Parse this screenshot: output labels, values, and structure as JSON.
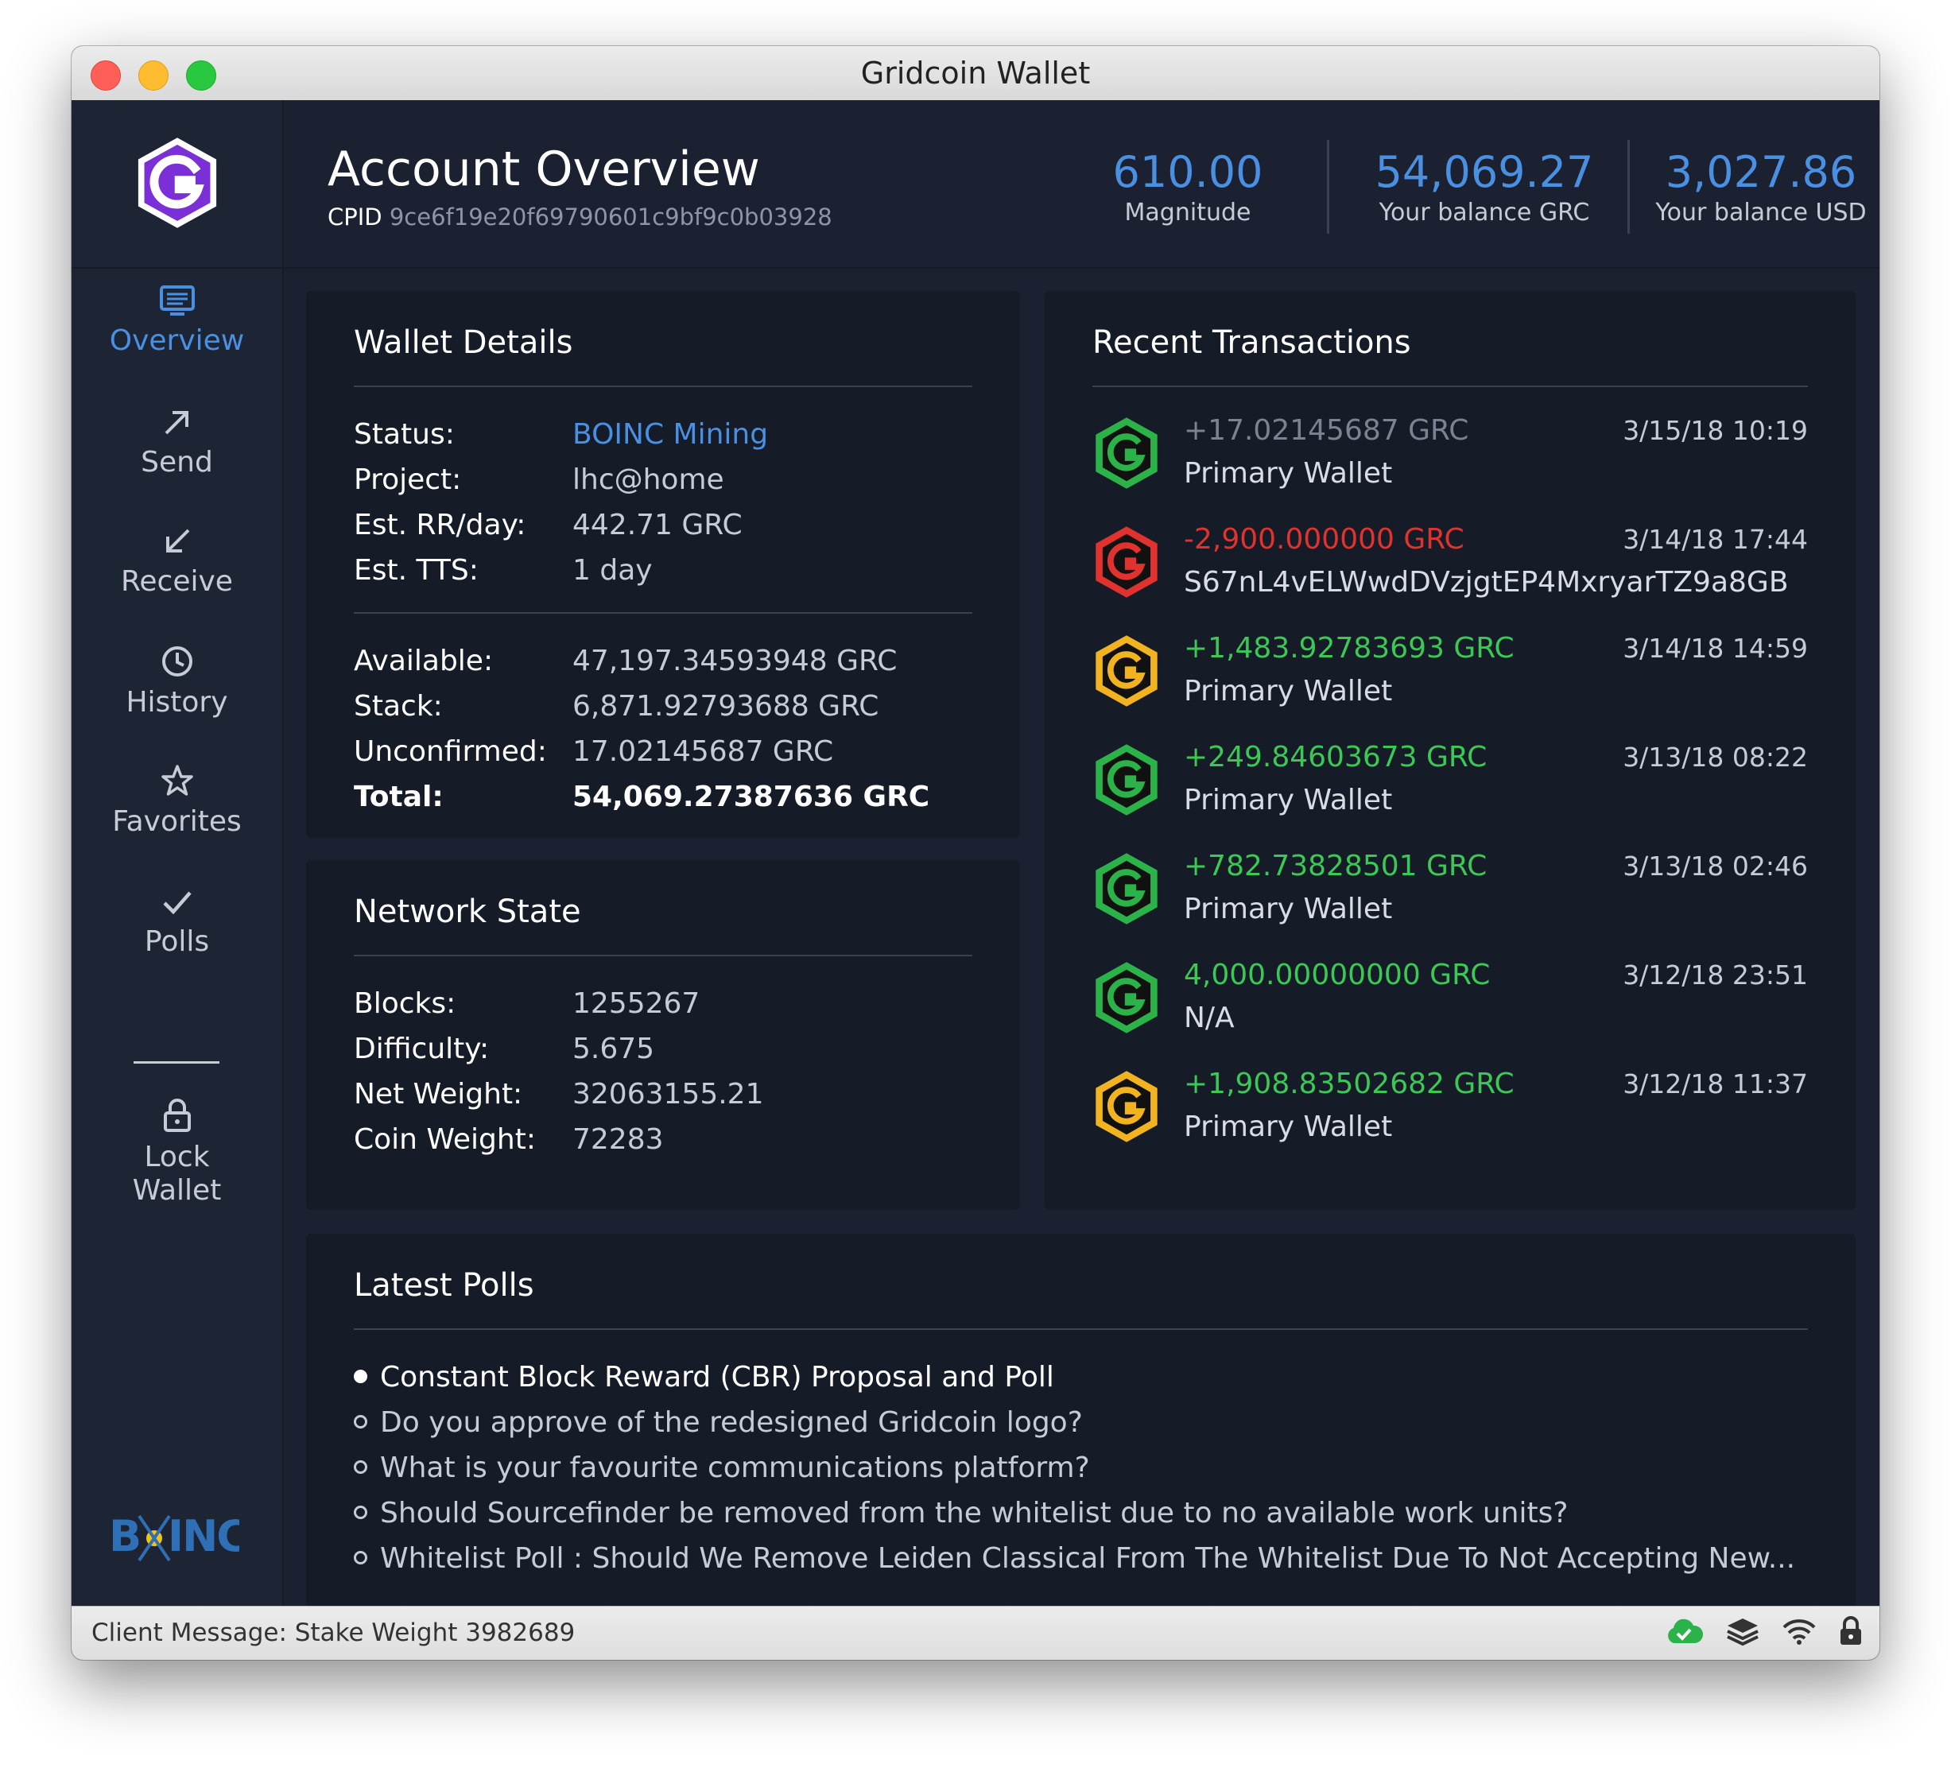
{
  "window": {
    "title": "Gridcoin Wallet"
  },
  "header": {
    "title": "Account Overview",
    "cpid_label": "CPID",
    "cpid_value": "9ce6f19e20f69790601c9bf9c0b03928",
    "stats": [
      {
        "value": "610.00",
        "caption": "Magnitude"
      },
      {
        "value": "54,069.27",
        "caption": "Your balance GRC"
      },
      {
        "value": "3,027.86",
        "caption": "Your balance USD"
      }
    ]
  },
  "sidebar": {
    "items": [
      {
        "label": "Overview",
        "icon": "monitor-icon",
        "active": true
      },
      {
        "label": "Send",
        "icon": "arrow-up-right-icon"
      },
      {
        "label": "Receive",
        "icon": "arrow-down-left-icon"
      },
      {
        "label": "History",
        "icon": "clock-icon"
      },
      {
        "label": "Favorites",
        "icon": "star-icon"
      },
      {
        "label": "Polls",
        "icon": "checkmark-icon"
      }
    ],
    "lock": {
      "line1": "Lock",
      "line2": "Wallet",
      "icon": "lock-icon"
    }
  },
  "wallet_details": {
    "title": "Wallet Details",
    "rows1": [
      {
        "key": "Status:",
        "value": "BOINC Mining"
      },
      {
        "key": "Project:",
        "value": "lhc@home"
      },
      {
        "key": "Est. RR/day:",
        "value": "442.71 GRC"
      },
      {
        "key": "Est. TTS:",
        "value": "1 day"
      }
    ],
    "rows2": [
      {
        "key": "Available:",
        "value": "47,197.34593948 GRC"
      },
      {
        "key": "Stack:",
        "value": "6,871.92793688 GRC"
      },
      {
        "key": "Unconfirmed:",
        "value": "17.02145687 GRC"
      },
      {
        "key": "Total:",
        "value": "54,069.27387636 GRC"
      }
    ]
  },
  "network_state": {
    "title": "Network State",
    "rows": [
      {
        "key": "Blocks:",
        "value": "1255267"
      },
      {
        "key": "Difficulty:",
        "value": "5.675"
      },
      {
        "key": "Net Weight:",
        "value": "32063155.21"
      },
      {
        "key": "Coin Weight:",
        "value": "72283"
      }
    ]
  },
  "recent_transactions": {
    "title": "Recent Transactions",
    "items": [
      {
        "amount": "+17.02145687 GRC",
        "date": "3/15/18 10:19",
        "address": "Primary Wallet",
        "kind": "neutral",
        "icon_color": "#2bb34a"
      },
      {
        "amount": "-2,900.000000 GRC",
        "date": "3/14/18 17:44",
        "address": "S67nL4vELWwdDVzjgtEP4MxryarTZ9a8GB",
        "kind": "neg",
        "icon_color": "#e0322f"
      },
      {
        "amount": "+1,483.92783693 GRC",
        "date": "3/14/18 14:59",
        "address": "Primary Wallet",
        "kind": "pos",
        "icon_color": "#f2b321"
      },
      {
        "amount": "+249.84603673 GRC",
        "date": "3/13/18 08:22",
        "address": "Primary Wallet",
        "kind": "pos",
        "icon_color": "#2bb34a"
      },
      {
        "amount": "+782.73828501 GRC",
        "date": "3/13/18 02:46",
        "address": "Primary Wallet",
        "kind": "pos",
        "icon_color": "#2bb34a"
      },
      {
        "amount": "4,000.00000000 GRC",
        "date": "3/12/18 23:51",
        "address": "N/A",
        "kind": "pos",
        "icon_color": "#2bb34a"
      },
      {
        "amount": "+1,908.83502682 GRC",
        "date": "3/12/18 11:37",
        "address": "Primary Wallet",
        "kind": "pos",
        "icon_color": "#f2b321"
      }
    ]
  },
  "latest_polls": {
    "title": "Latest Polls",
    "items": [
      {
        "text": "Constant Block Reward (CBR) Proposal and Poll",
        "active": true
      },
      {
        "text": "Do you approve of the redesigned Gridcoin logo?"
      },
      {
        "text": "What is your favourite communications platform?"
      },
      {
        "text": "Should Sourcefinder be removed from the whitelist due to no available work units?"
      },
      {
        "text": "Whitelist Poll : Should We Remove Leiden Classical From The Whitelist Due To Not Accepting New..."
      }
    ]
  },
  "statusbar": {
    "message": "Client Message: Stake Weight 3982689",
    "icons": [
      "cloud-check-icon",
      "layers-icon",
      "wifi-icon",
      "lock-icon"
    ]
  },
  "colors": {
    "accent": "#4a90e2",
    "positive": "#3cc854",
    "negative": "#e0322f",
    "brand_purple": "#7b2fd6"
  }
}
